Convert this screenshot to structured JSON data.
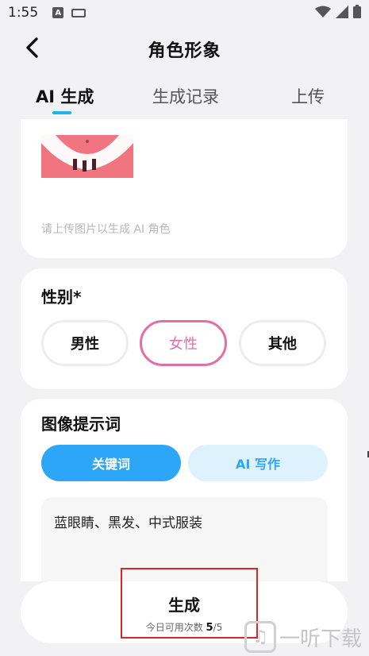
{
  "status_bar": {
    "time": "1:55",
    "badge": "A"
  },
  "header": {
    "title": "角色形象"
  },
  "tabs": [
    {
      "label": "AI 生成",
      "active": true
    },
    {
      "label": "生成记录",
      "active": false
    },
    {
      "label": "上传",
      "active": false
    }
  ],
  "upload": {
    "hint": "请上传图片以生成 AI 角色"
  },
  "gender": {
    "title": "性别*",
    "options": [
      "男性",
      "女性",
      "其他"
    ],
    "selected": "女性"
  },
  "prompt": {
    "title": "图像提示词",
    "modes": [
      "关键词",
      "AI 写作"
    ],
    "selected_mode": "关键词",
    "value": "蓝眼睛、黑发、中式服装"
  },
  "generate": {
    "label": "生成",
    "quota_label": "今日可用次数",
    "quota_used": "5",
    "quota_total": "/5"
  },
  "watermark": {
    "text": "一听下载"
  },
  "colors": {
    "accent_blue": "#2ea6f7",
    "tab_indicator": "#1cb4e8",
    "female_pink": "#e26ea5",
    "highlight_red": "#d9262b"
  }
}
